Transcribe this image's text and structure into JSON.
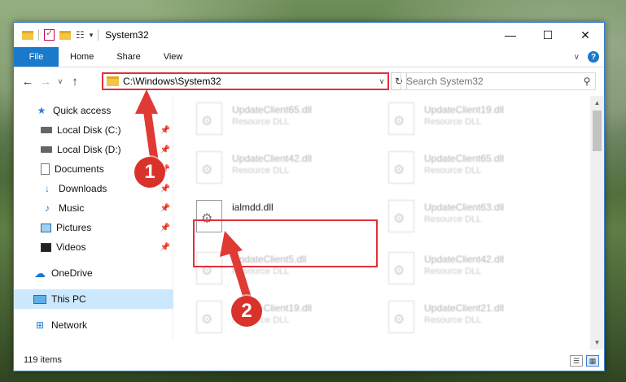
{
  "window": {
    "title": "System32",
    "controls": {
      "minimize": "—",
      "maximize": "☐",
      "close": "✕"
    }
  },
  "ribbon": {
    "tabs": [
      {
        "label": "File"
      },
      {
        "label": "Home"
      },
      {
        "label": "Share"
      },
      {
        "label": "View"
      }
    ]
  },
  "address": {
    "path": "C:\\Windows\\System32",
    "search_placeholder": "Search System32"
  },
  "nav": {
    "items": [
      {
        "label": "Quick access",
        "icon": "star-icon",
        "pinned": false
      },
      {
        "label": "Local Disk (C:)",
        "icon": "drive-icon",
        "pinned": true
      },
      {
        "label": "Local Disk (D:)",
        "icon": "drive-icon",
        "pinned": true
      },
      {
        "label": "Documents",
        "icon": "documents-icon",
        "pinned": true
      },
      {
        "label": "Downloads",
        "icon": "downloads-icon",
        "pinned": true
      },
      {
        "label": "Music",
        "icon": "music-icon",
        "pinned": true
      },
      {
        "label": "Pictures",
        "icon": "pictures-icon",
        "pinned": true
      },
      {
        "label": "Videos",
        "icon": "videos-icon",
        "pinned": true
      },
      {
        "label": "OneDrive",
        "icon": "onedrive-icon",
        "pinned": false
      },
      {
        "label": "This PC",
        "icon": "this-pc-icon",
        "pinned": false,
        "selected": true
      },
      {
        "label": "Network",
        "icon": "network-icon",
        "pinned": false
      }
    ]
  },
  "files": [
    {
      "name": "UpdateClient65.dll",
      "type": "Resource DLL",
      "blurred": true
    },
    {
      "name": "UpdateClient19.dll",
      "type": "Resource DLL",
      "blurred": true
    },
    {
      "name": "UpdateClient42.dll",
      "type": "Resource DLL",
      "blurred": true
    },
    {
      "name": "UpdateClient65.dll",
      "type": "Resource DLL",
      "blurred": true
    },
    {
      "name": "ialmdd.dll",
      "type": "",
      "blurred": false,
      "highlighted": true
    },
    {
      "name": "UpdateClient63.dll",
      "type": "Resource DLL",
      "blurred": true
    },
    {
      "name": "UpdateClient5.dll",
      "type": "Resource DLL",
      "blurred": true
    },
    {
      "name": "UpdateClient42.dll",
      "type": "Resource DLL",
      "blurred": true
    },
    {
      "name": "UpdateClient19.dll",
      "type": "Resource DLL",
      "blurred": true
    },
    {
      "name": "UpdateClient21.dll",
      "type": "Resource DLL",
      "blurred": true
    }
  ],
  "status": {
    "item_count": "119 items"
  },
  "annotations": {
    "step1": "1",
    "step2": "2",
    "color": "#d9322b"
  },
  "colors": {
    "accent": "#1979ca",
    "highlight": "#e0303a",
    "selected": "#cce8ff"
  }
}
